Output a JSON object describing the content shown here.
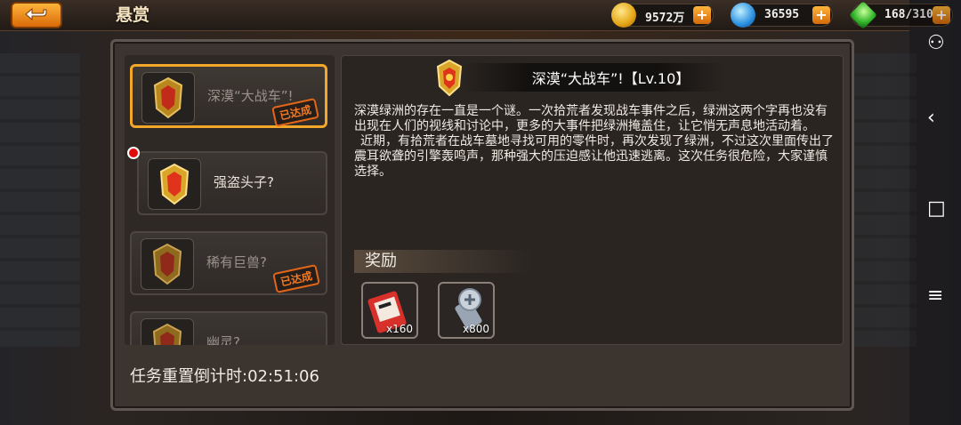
{
  "header": {
    "title": "悬赏",
    "gold": "9572万",
    "gems": "36595",
    "energy": "168/310"
  },
  "missions": [
    {
      "label": "深漠“大战车”!",
      "status": "已达成"
    },
    {
      "label": "强盗头子?",
      "status": ""
    },
    {
      "label": "稀有巨兽?",
      "status": "已达成"
    },
    {
      "label": "幽灵?",
      "status": ""
    }
  ],
  "detail": {
    "title": "深漠“大战车”!【Lv.10】",
    "description_1": "深漠绿洲的存在一直是一个谜。一次拾荒者发现战车事件之后，绿洲这两个字再也没有出现在人们的视线和讨论中，更多的大事件把绿洲掩盖住，让它悄无声息地活动着。",
    "description_2": "近期，有拾荒者在战车墓地寻找可用的零件时，再次发现了绿洲，不过这次里面传出了震耳欲聋的引擎轰鸣声，那种强大的压迫感让他迅速逃离。这次任务很危险，大家谨慎选择。",
    "rewards_label": "奖励",
    "rewards": [
      {
        "icon": "ticket-icon",
        "count": "x160"
      },
      {
        "icon": "screw-icon",
        "count": "x800"
      }
    ]
  },
  "footer": {
    "timer_label": "任务重置倒计时:",
    "timer_value": "02:51:06"
  },
  "colors": {
    "accent": "#f2a72a",
    "stamp": "#f37a24",
    "badge": "#e20b0b"
  }
}
